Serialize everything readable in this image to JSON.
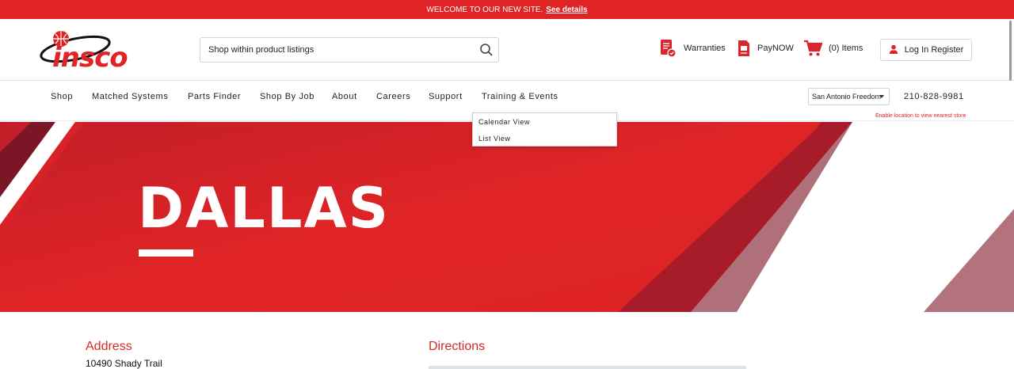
{
  "announcement": {
    "text": "WELCOME TO OUR NEW SITE.",
    "link": "See details"
  },
  "header": {
    "logo_text": "insco",
    "search": {
      "placeholder": "Shop within product listings"
    },
    "links": {
      "warranties": "Warranties",
      "paynow": "PayNOW",
      "cart": "(0) Items"
    },
    "login": "Log In Register"
  },
  "nav": {
    "items": [
      "Shop",
      "Matched Systems",
      "Parts Finder",
      "Shop By Job",
      "About",
      "Careers",
      "Support",
      "Training & Events"
    ],
    "store": "San Antonio Freedom",
    "phone": "210-828-9981",
    "enable_location": "Enable location to view nearest store"
  },
  "dropdown": {
    "items": [
      "Calendar View",
      "List View"
    ]
  },
  "hero": {
    "title": "DALLAS"
  },
  "content": {
    "address_heading": "Address",
    "address_line": "10490 Shady Trail",
    "directions_heading": "Directions"
  },
  "colors": {
    "brand_red": "#e02426",
    "dark_red": "#a61b28",
    "heading_red": "#d32a24"
  }
}
